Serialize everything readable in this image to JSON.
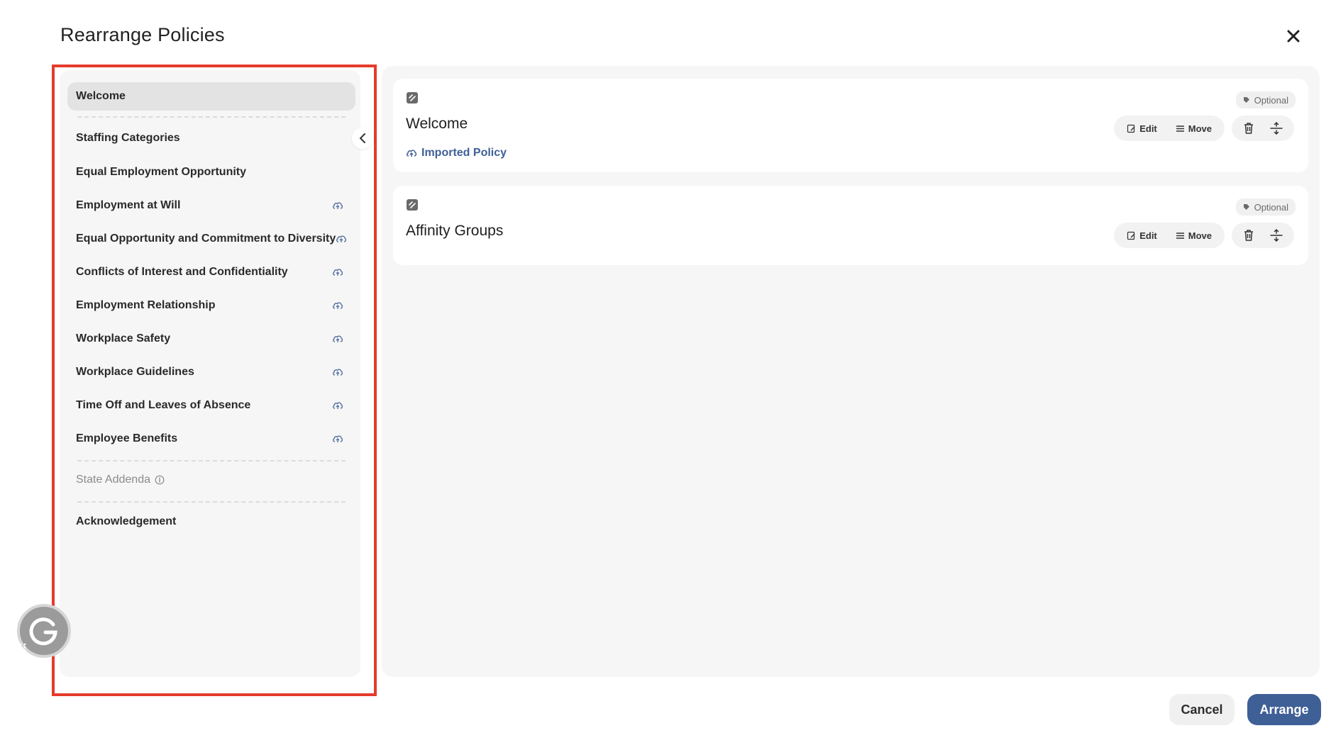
{
  "modal": {
    "title": "Rearrange Policies"
  },
  "sidebar": {
    "items": [
      {
        "label": "Welcome",
        "active": true,
        "imported": false
      },
      {
        "label": "Staffing Categories",
        "imported": false
      },
      {
        "label": "Equal Employment Opportunity",
        "imported": false
      },
      {
        "label": "Employment at Will",
        "imported": true
      },
      {
        "label": "Equal Opportunity and Commitment to Diversity",
        "imported": true
      },
      {
        "label": "Conflicts of Interest and Confidentiality",
        "imported": true
      },
      {
        "label": "Employment Relationship",
        "imported": true
      },
      {
        "label": "Workplace Safety",
        "imported": true
      },
      {
        "label": "Workplace Guidelines",
        "imported": true
      },
      {
        "label": "Time Off and Leaves of Absence",
        "imported": true
      },
      {
        "label": "Employee Benefits",
        "imported": true
      }
    ],
    "state_addenda": "State Addenda",
    "acknowledgement": "Acknowledgement"
  },
  "cards": [
    {
      "title": "Welcome",
      "badge": "Optional",
      "imported_label": "Imported Policy",
      "edit": "Edit",
      "move": "Move"
    },
    {
      "title": "Affinity Groups",
      "badge": "Optional",
      "edit": "Edit",
      "move": "Move"
    }
  ],
  "footer": {
    "cancel": "Cancel",
    "arrange": "Arrange"
  },
  "colors": {
    "accent": "#3f5f97",
    "highlight": "#e53b2b"
  },
  "icons": [
    "close-icon",
    "chevron-left-icon",
    "cloud-sync-icon",
    "info-icon",
    "drag-handle-icon",
    "tag-icon",
    "edit-icon",
    "list-icon",
    "trash-icon",
    "split-icon",
    "grammarly-icon"
  ]
}
